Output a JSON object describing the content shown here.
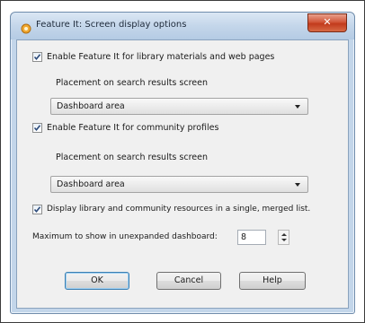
{
  "window": {
    "title": "Feature It: Screen display options",
    "close_glyph": "✕"
  },
  "options": {
    "enable_library": {
      "checked": true,
      "label": "Enable Feature It for library materials and web pages"
    },
    "placement_label_1": "Placement on search results screen",
    "placement_select_1": {
      "value": "Dashboard area"
    },
    "enable_community": {
      "checked": true,
      "label": "Enable Feature It for community profiles"
    },
    "placement_label_2": "Placement on search results screen",
    "placement_select_2": {
      "value": "Dashboard area"
    },
    "merged_list": {
      "checked": true,
      "label": "Display library and community resources in a single, merged list."
    },
    "maximum_label": "Maximum to show in unexpanded dashboard:",
    "maximum_value": "8"
  },
  "buttons": {
    "ok": "OK",
    "cancel": "Cancel",
    "help": "Help"
  },
  "icons": {
    "title": "feature-it-app-icon",
    "check": "checkmark-icon",
    "dropdown": "chevron-down-icon",
    "spin_up": "spin-up-icon",
    "spin_down": "spin-down-icon"
  }
}
